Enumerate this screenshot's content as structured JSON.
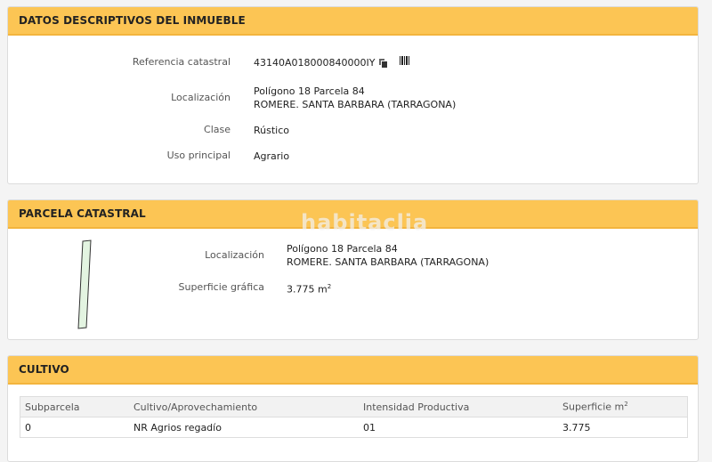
{
  "datos": {
    "title": "DATOS DESCRIPTIVOS DEL INMUEBLE",
    "ref_label": "Referencia catastral",
    "ref_value": "43140A018000840000IY",
    "loc_label": "Localización",
    "loc_line1": "Polígono 18 Parcela 84",
    "loc_line2": "ROMERE. SANTA BARBARA (TARRAGONA)",
    "clase_label": "Clase",
    "clase_value": "Rústico",
    "uso_label": "Uso principal",
    "uso_value": "Agrario"
  },
  "parcela": {
    "title": "PARCELA CATASTRAL",
    "loc_label": "Localización",
    "loc_line1": "Polígono 18 Parcela 84",
    "loc_line2": "ROMERE. SANTA BARBARA (TARRAGONA)",
    "sup_label": "Superficie gráfica",
    "sup_value": "3.775 m",
    "sup_unit_exp": "2"
  },
  "watermark": "habitaclia",
  "cultivo": {
    "title": "CULTIVO",
    "headers": [
      "Subparcela",
      "Cultivo/Aprovechamiento",
      "Intensidad Productiva",
      "Superficie m"
    ],
    "header_exp": "2",
    "rows": [
      [
        "0",
        "NR Agrios regadío",
        "01",
        "3.775"
      ]
    ]
  },
  "icons": {
    "copy": "copy-icon",
    "barcode": "barcode-icon"
  },
  "colors": {
    "header_bg": "#fcc554",
    "parcel_fill": "#e3f4e1"
  }
}
